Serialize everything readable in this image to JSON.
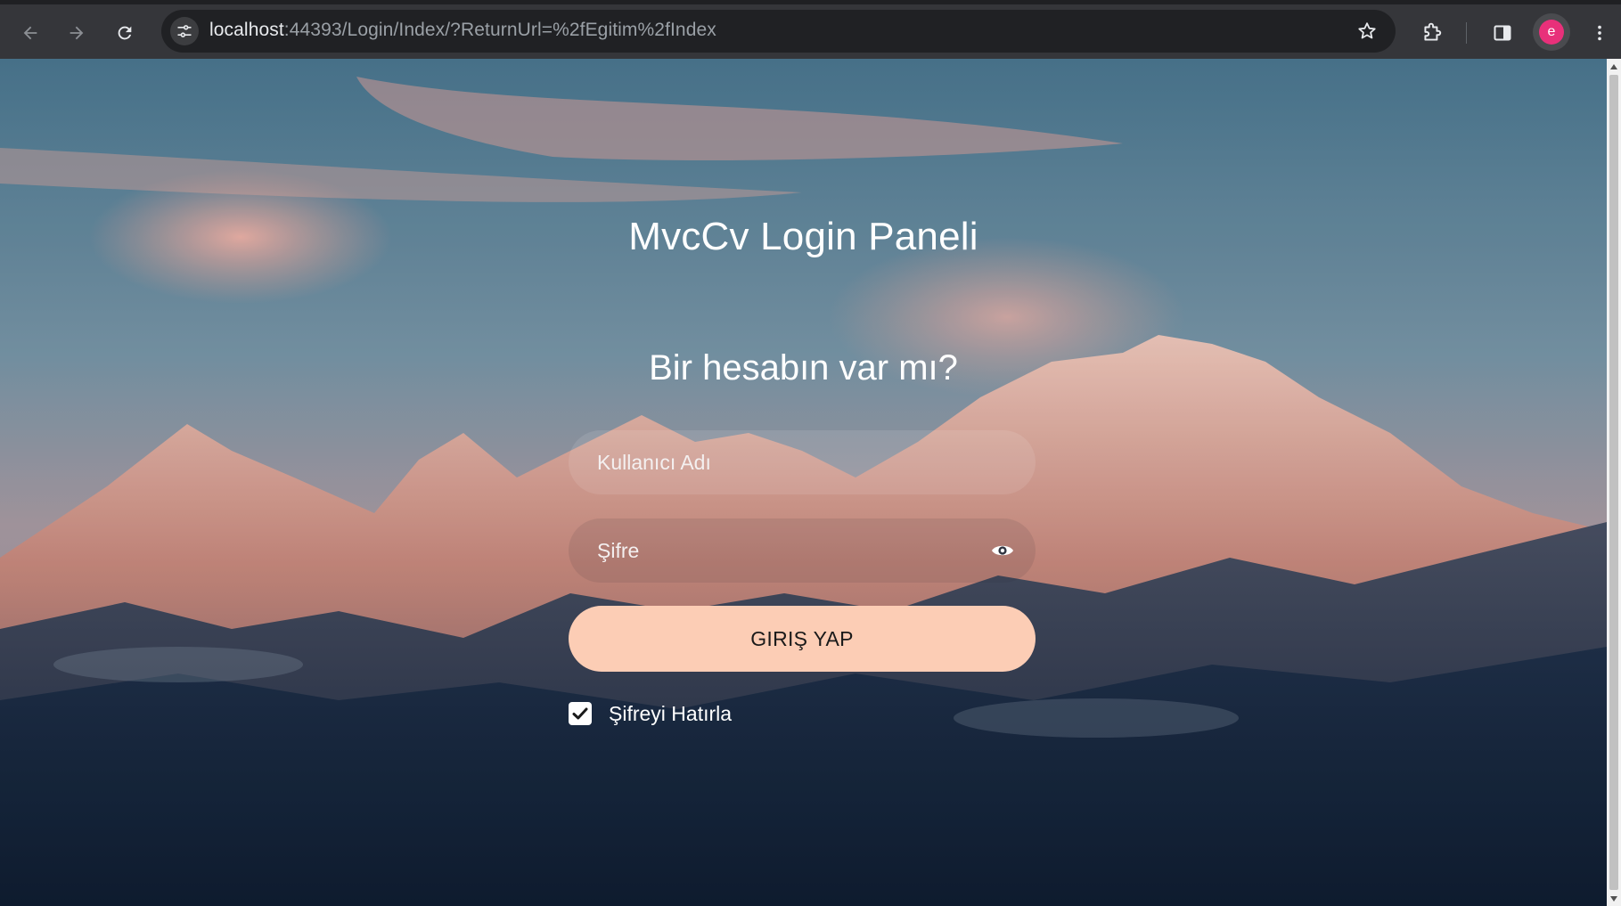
{
  "browser": {
    "url_host": "localhost",
    "url_rest": ":44393/Login/Index/?ReturnUrl=%2fEgitim%2fIndex",
    "profile_initial": "e",
    "icons": {
      "back": "arrow-left-icon",
      "forward": "arrow-right-icon",
      "reload": "reload-icon",
      "site_info": "tune-icon",
      "bookmark": "star-icon",
      "extensions": "puzzle-icon",
      "side_panel": "side-panel-icon",
      "menu": "kebab-menu-icon"
    },
    "colors": {
      "toolbar": "#35363a",
      "omnibox": "#202124",
      "avatar": "#e8307a"
    }
  },
  "login": {
    "title": "MvcCv Login Paneli",
    "subtitle": "Bir hesabın var mı?",
    "username_placeholder": "Kullanıcı Adı",
    "password_placeholder": "Şifre",
    "submit_label": "GIRIŞ YAP",
    "remember_label": "Şifreyi Hatırla",
    "remember_checked": true,
    "icons": {
      "password_toggle": "eye-icon",
      "checkbox": "checkmark-icon"
    },
    "colors": {
      "button": "#fccdb5",
      "text": "#ffffff"
    }
  }
}
